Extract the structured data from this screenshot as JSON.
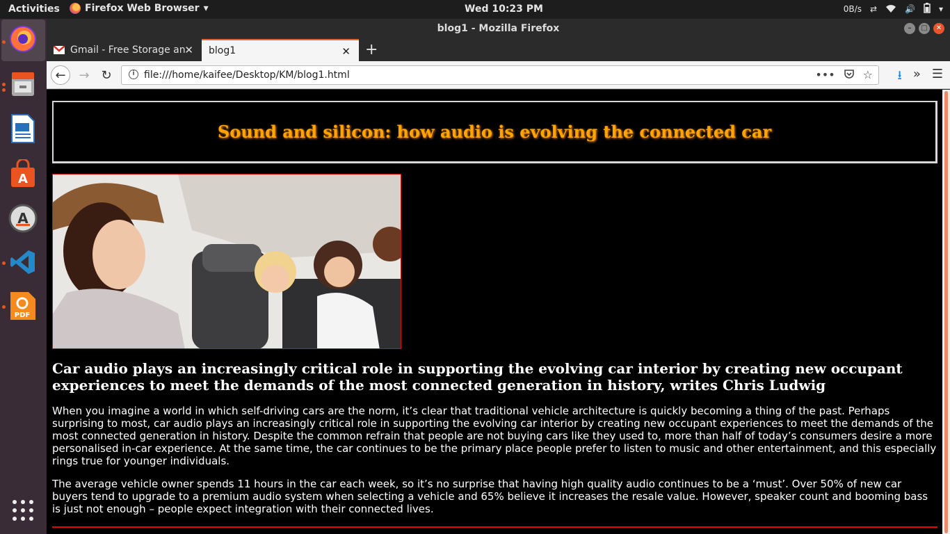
{
  "topbar": {
    "activities": "Activities",
    "app_name": "Firefox Web Browser",
    "clock": "Wed 10:23 PM",
    "net_speed": "0B/s"
  },
  "window": {
    "title": "blog1 - Mozilla Firefox"
  },
  "tabs": [
    {
      "label": "Gmail - Free Storage and",
      "active": false
    },
    {
      "label": "blog1",
      "active": true
    }
  ],
  "navbar": {
    "url": "file:///home/kaifee/Desktop/KM/blog1.html"
  },
  "page": {
    "heading": "Sound and silicon: how audio is evolving the connected car",
    "lede": "Car audio plays an increasingly critical role in supporting the evolving car interior by creating new occupant experiences to meet the demands of the most connected generation in history, writes Chris Ludwig",
    "paragraph1": "When you imagine a world in which self-driving cars are the norm, it’s clear that traditional vehicle architecture is quickly becoming a thing of the past. Perhaps surprising to most, car audio plays an increasingly critical role in supporting the evolving car interior by creating new occupant experiences to meet the demands of the most connected generation in history. Despite the common refrain that people are not buying cars like they used to, more than half of today’s consumers desire a more personalised in-car experience. At the same time, the car continues to be the primary place people prefer to listen to music and other entertainment, and this especially rings true for younger individuals.",
    "paragraph2": "The average vehicle owner spends 11 hours in the car each week, so it’s no surprise that having high quality audio continues to be a ‘must’. Over 50% of new car buyers tend to upgrade to a premium audio system when selecting a vehicle and 65% believe it increases the resale value. However, speaker count and booming bass is just not enough – people expect integration with their connected lives."
  },
  "colors": {
    "heading": "#ffa400",
    "accent_red": "#e00000",
    "ubuntu_orange": "#e95420"
  }
}
